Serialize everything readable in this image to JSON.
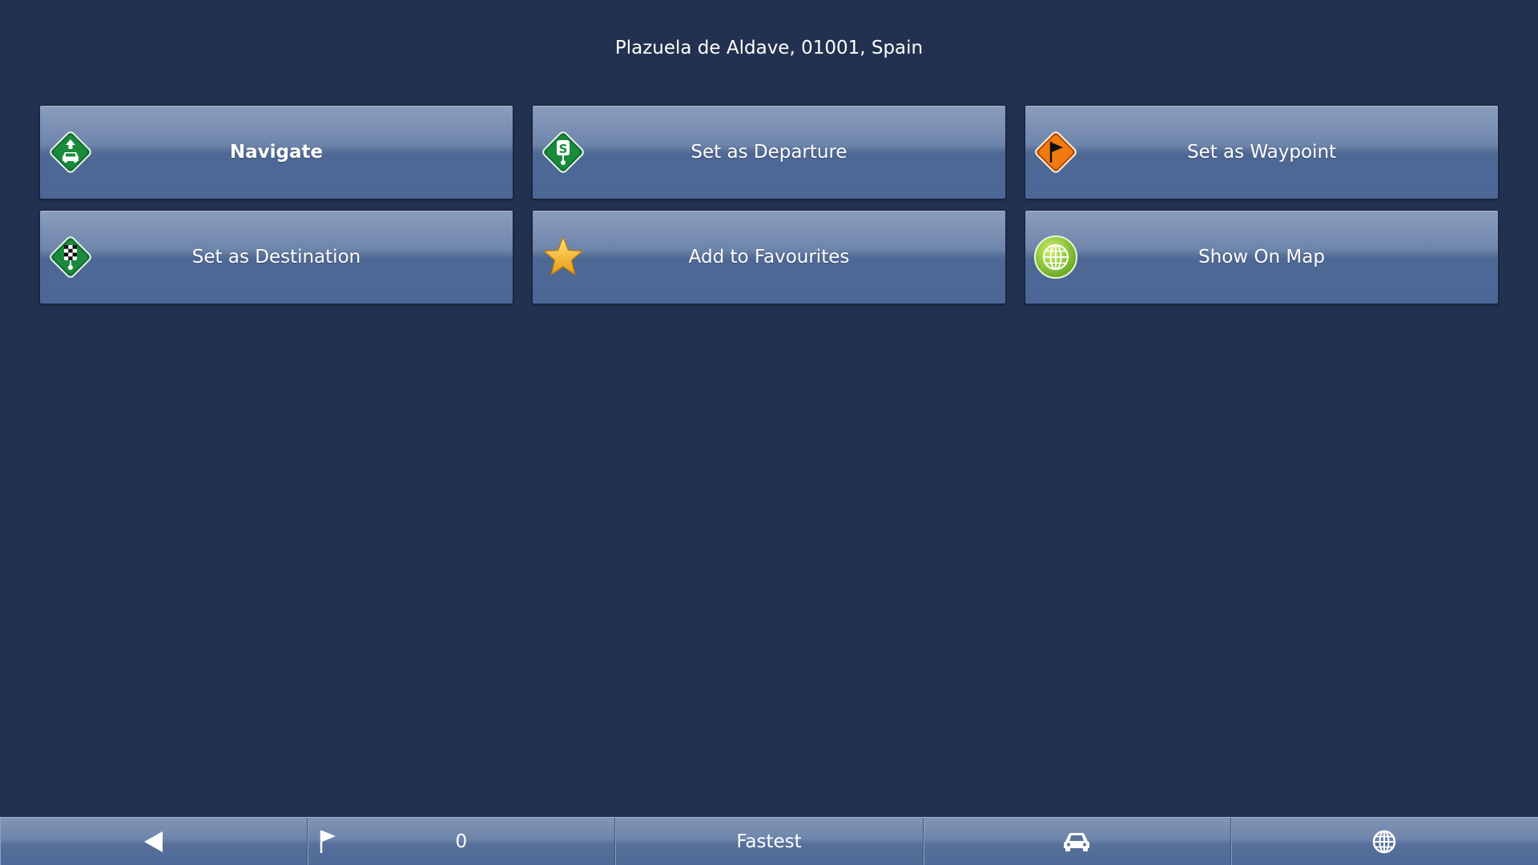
{
  "header": {
    "address": "Plazuela de Aldave, 01001, Spain"
  },
  "actions": [
    {
      "label": "Navigate",
      "icon": "navigate-car-icon"
    },
    {
      "label": "Set as Departure",
      "icon": "departure-icon"
    },
    {
      "label": "Set as Waypoint",
      "icon": "waypoint-flag-icon"
    },
    {
      "label": "Set as Destination",
      "icon": "destination-checkered-icon"
    },
    {
      "label": "Add to Favourites",
      "icon": "star-icon"
    },
    {
      "label": "Show On Map",
      "icon": "globe-icon"
    }
  ],
  "bottom_bar": {
    "back_icon": "back-arrow-icon",
    "waypoint_count": "0",
    "waypoint_icon": "flag-icon",
    "route_mode": "Fastest",
    "vehicle_icon": "car-icon",
    "map_icon": "globe-icon"
  },
  "colors": {
    "background": "#22314f",
    "button": "#4c6796",
    "green_sign": "#1a8a3c",
    "orange_sign": "#f07a10",
    "star": "#f5b820",
    "globe": "#8cc63f"
  }
}
